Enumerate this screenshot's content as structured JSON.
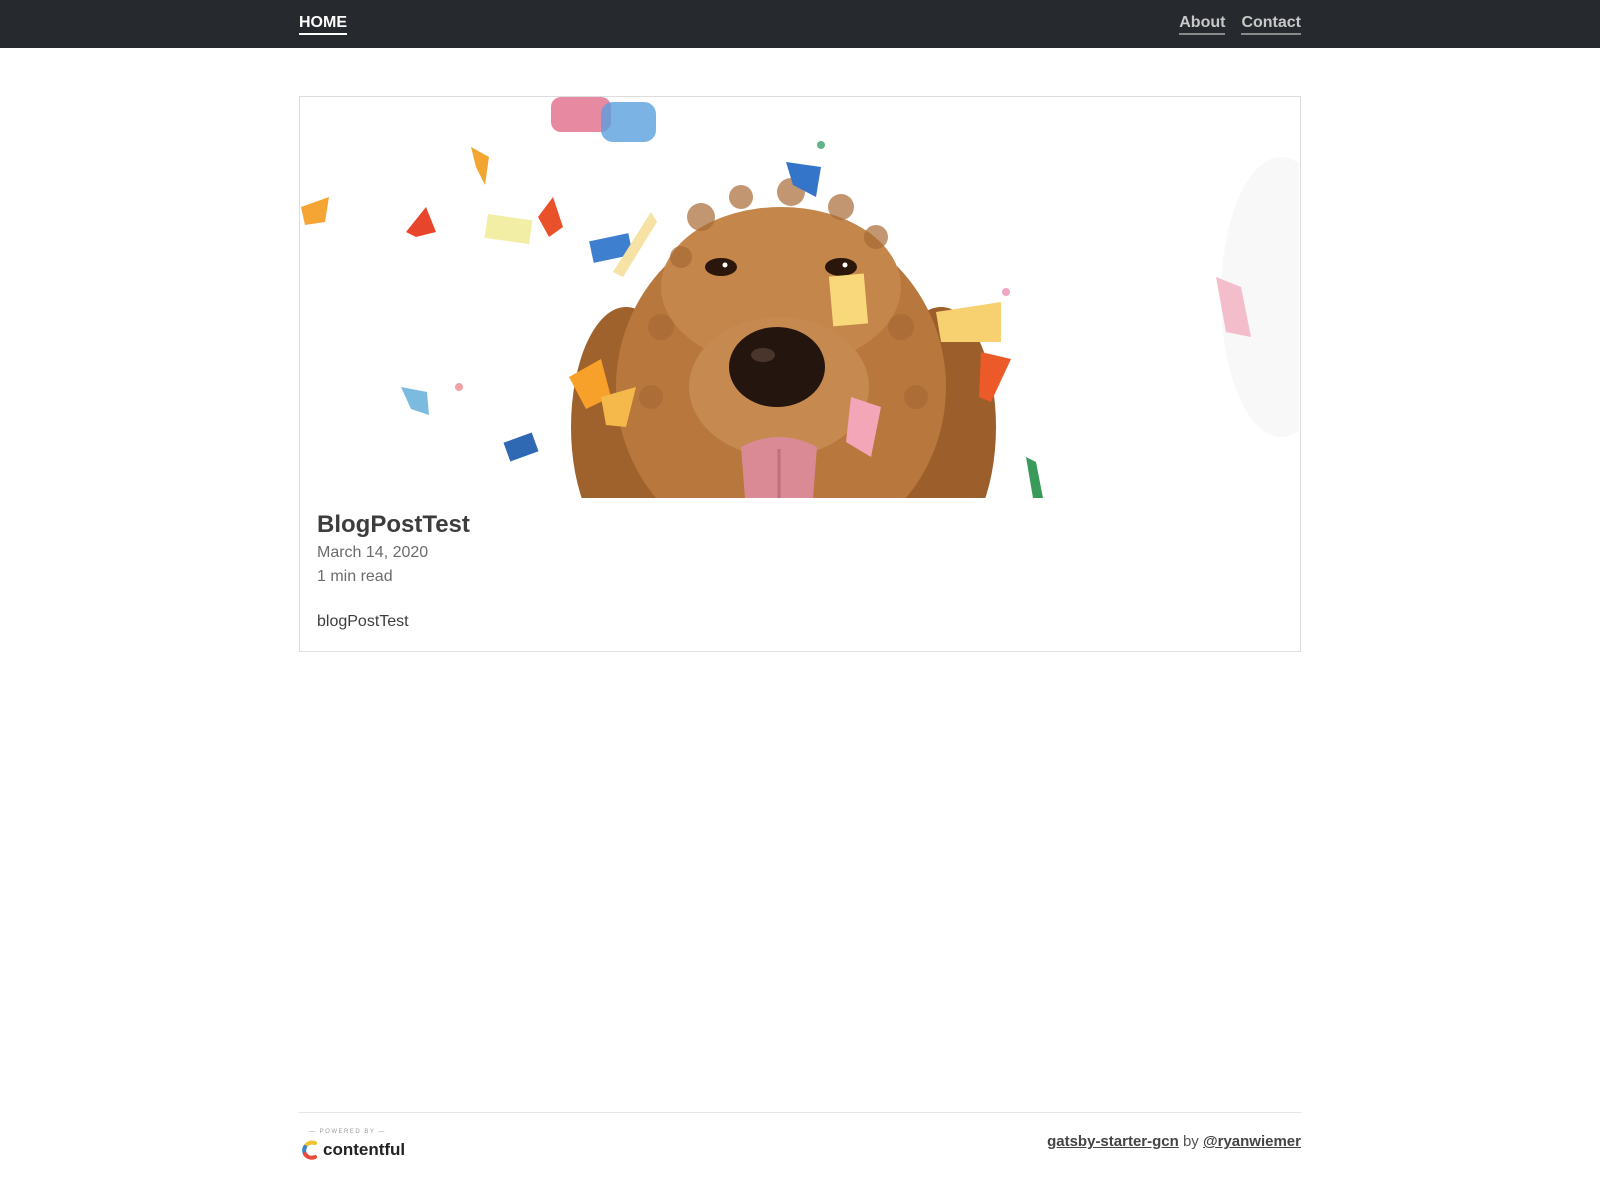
{
  "nav": {
    "home_label": "HOME",
    "links": [
      {
        "label": "About"
      },
      {
        "label": "Contact"
      }
    ]
  },
  "post": {
    "title": "BlogPostTest",
    "date": "March 14, 2020",
    "read_time": "1 min read",
    "excerpt": "blogPostTest",
    "image_subject": "dog-with-confetti"
  },
  "footer": {
    "powered_by": "— POWERED BY —",
    "brand": "contentful",
    "credit_repo": "gatsby-starter-gcn",
    "credit_by": "by",
    "credit_author": "@ryanwiemer"
  },
  "colors": {
    "topbar": "#262a2f",
    "text": "#333333",
    "muted": "#6b6b6b"
  }
}
